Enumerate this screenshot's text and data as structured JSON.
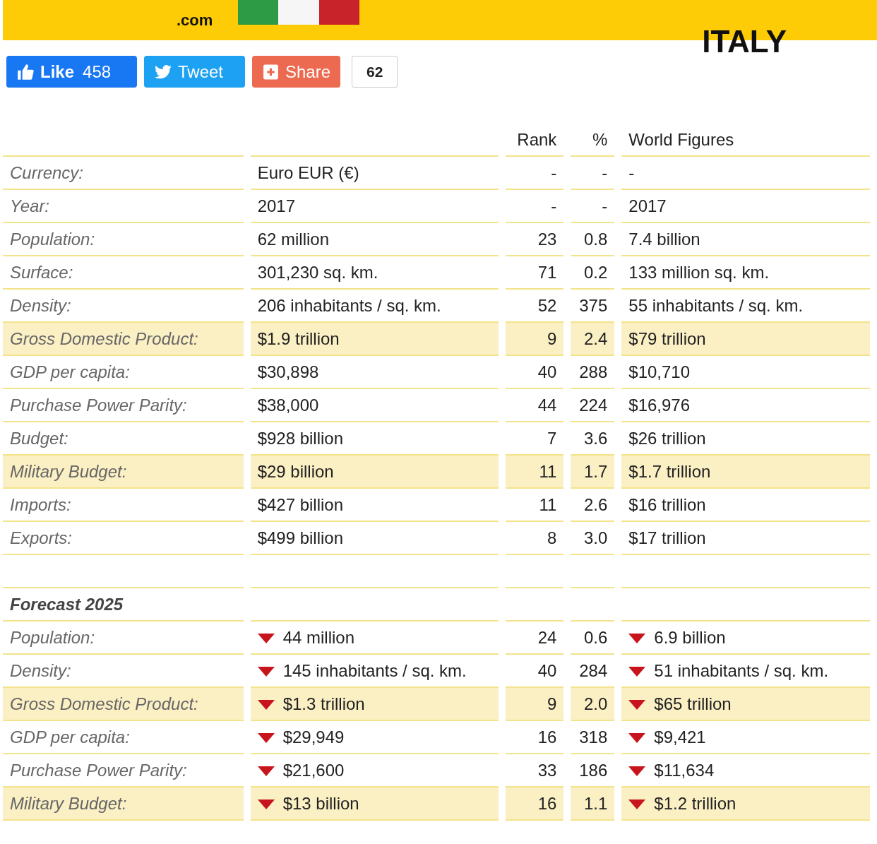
{
  "header": {
    "domain": ".com",
    "country": "ITALY"
  },
  "social": {
    "like_label": "Like",
    "like_count": "458",
    "tweet_label": "Tweet",
    "share_label": "Share",
    "share_count": "62"
  },
  "table": {
    "columns": [
      "Rank",
      "%",
      "World Figures"
    ],
    "rows": [
      {
        "label": "Currency:",
        "value": "Euro EUR (€)",
        "rank": "-",
        "percent": "-",
        "world": "-",
        "highlighted": false
      },
      {
        "label": "Year:",
        "value": "2017",
        "rank": "-",
        "percent": "-",
        "world": "2017",
        "highlighted": false
      },
      {
        "label": "Population:",
        "value": "62 million",
        "rank": "23",
        "percent": "0.8",
        "world": "7.4 billion",
        "highlighted": false
      },
      {
        "label": "Surface:",
        "value": "301,230 sq. km.",
        "rank": "71",
        "percent": "0.2",
        "world": "133 million sq. km.",
        "highlighted": false
      },
      {
        "label": "Density:",
        "value": "206 inhabitants / sq. km.",
        "rank": "52",
        "percent": "375",
        "world": "55 inhabitants / sq. km.",
        "highlighted": false
      },
      {
        "label": "Gross Domestic Product:",
        "value": "$1.9 trillion",
        "rank": "9",
        "percent": "2.4",
        "world": "$79 trillion",
        "highlighted": true
      },
      {
        "label": "GDP per capita:",
        "value": "$30,898",
        "rank": "40",
        "percent": "288",
        "world": "$10,710",
        "highlighted": false
      },
      {
        "label": "Purchase Power Parity:",
        "value": "$38,000",
        "rank": "44",
        "percent": "224",
        "world": "$16,976",
        "highlighted": false
      },
      {
        "label": "Budget:",
        "value": "$928 billion",
        "rank": "7",
        "percent": "3.6",
        "world": "$26 trillion",
        "highlighted": false
      },
      {
        "label": "Military Budget:",
        "value": "$29 billion",
        "rank": "11",
        "percent": "1.7",
        "world": "$1.7 trillion",
        "highlighted": true
      },
      {
        "label": "Imports:",
        "value": "$427 billion",
        "rank": "11",
        "percent": "2.6",
        "world": "$16 trillion",
        "highlighted": false
      },
      {
        "label": "Exports:",
        "value": "$499 billion",
        "rank": "8",
        "percent": "3.0",
        "world": "$17 trillion",
        "highlighted": false
      }
    ]
  },
  "forecast": {
    "title": "Forecast 2025",
    "rows": [
      {
        "label": "Population:",
        "value": "44 million",
        "value_down": true,
        "rank": "24",
        "percent": "0.6",
        "world": "6.9 billion",
        "world_down": true,
        "highlighted": false
      },
      {
        "label": "Density:",
        "value": "145 inhabitants / sq. km.",
        "value_down": true,
        "rank": "40",
        "percent": "284",
        "world": "51 inhabitants / sq. km.",
        "world_down": true,
        "highlighted": false
      },
      {
        "label": "Gross Domestic Product:",
        "value": "$1.3 trillion",
        "value_down": true,
        "rank": "9",
        "percent": "2.0",
        "world": "$65 trillion",
        "world_down": true,
        "highlighted": true
      },
      {
        "label": "GDP per capita:",
        "value": "$29,949",
        "value_down": true,
        "rank": "16",
        "percent": "318",
        "world": "$9,421",
        "world_down": true,
        "highlighted": false
      },
      {
        "label": "Purchase Power Parity:",
        "value": "$21,600",
        "value_down": true,
        "rank": "33",
        "percent": "186",
        "world": "$11,634",
        "world_down": true,
        "highlighted": false
      },
      {
        "label": "Military Budget:",
        "value": "$13 billion",
        "value_down": true,
        "rank": "16",
        "percent": "1.1",
        "world": "$1.2 trillion",
        "world_down": true,
        "highlighted": true
      }
    ]
  }
}
